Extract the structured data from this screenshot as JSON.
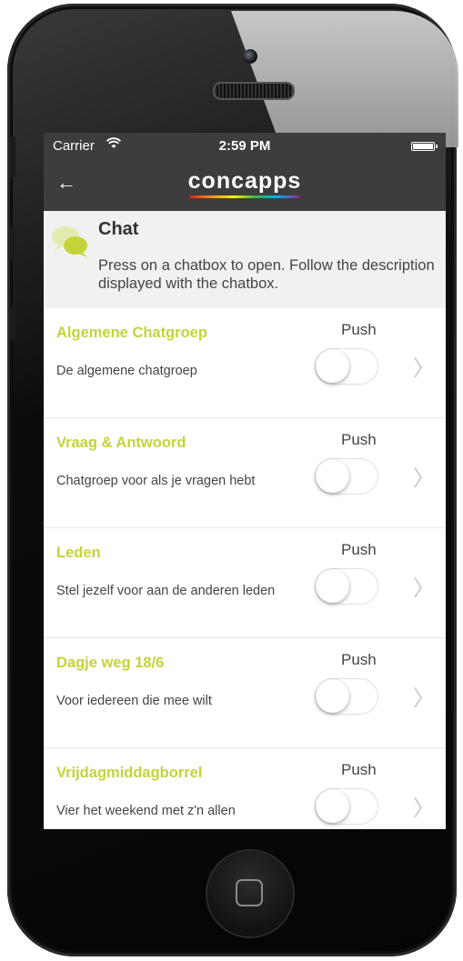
{
  "status_bar": {
    "carrier": "Carrier",
    "wifi_icon": "wifi-icon",
    "time": "2:59 PM",
    "battery_icon": "battery-icon"
  },
  "nav_bar": {
    "back_icon": "←",
    "brand": "concapps"
  },
  "header": {
    "title": "Chat",
    "description": "Press on a chatbox to open. Follow the description displayed with the chatbox.",
    "icon": "chat-bubbles-icon"
  },
  "chatboxes": [
    {
      "title": "Algemene Chatgroep",
      "description": "De algemene chatgroep",
      "push_label": "Push",
      "push_enabled": false
    },
    {
      "title": "Vraag & Antwoord",
      "description": "Chatgroep voor als je vragen hebt",
      "push_label": "Push",
      "push_enabled": false
    },
    {
      "title": "Leden",
      "description": "Stel jezelf voor aan de anderen leden",
      "push_label": "Push",
      "push_enabled": false
    },
    {
      "title": "Dagje weg 18/6",
      "description": "Voor iedereen die mee wilt",
      "push_label": "Push",
      "push_enabled": false
    },
    {
      "title": "Vrijdagmiddagborrel",
      "description": "Vier het weekend met z'n allen",
      "push_label": "Push",
      "push_enabled": false
    }
  ],
  "colors": {
    "accent": "#c5d33a",
    "bar_background": "#3d3d3d",
    "header_background": "#f1f1f1"
  }
}
